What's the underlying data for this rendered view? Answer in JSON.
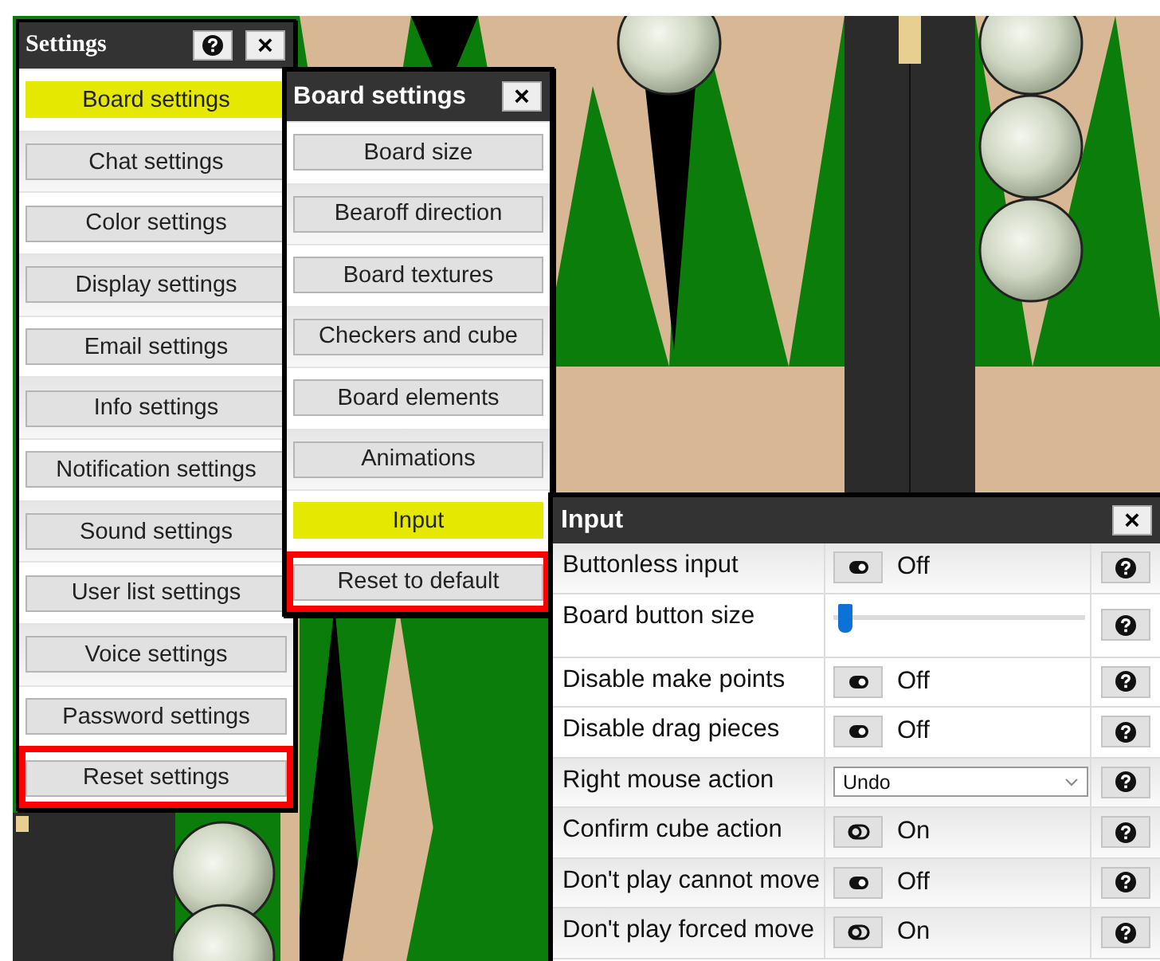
{
  "settings_window": {
    "title": "Settings",
    "close": "×",
    "items": [
      {
        "label": "Board settings",
        "selected": true,
        "kind": "setting"
      },
      {
        "label": "Chat settings",
        "selected": false,
        "kind": "setting"
      },
      {
        "label": "Color settings",
        "selected": false,
        "kind": "setting"
      },
      {
        "label": "Display settings",
        "selected": false,
        "kind": "setting"
      },
      {
        "label": "Email settings",
        "selected": false,
        "kind": "setting"
      },
      {
        "label": "Info settings",
        "selected": false,
        "kind": "setting"
      },
      {
        "label": "Notification settings",
        "selected": false,
        "kind": "setting"
      },
      {
        "label": "Sound settings",
        "selected": false,
        "kind": "setting"
      },
      {
        "label": "User list settings",
        "selected": false,
        "kind": "setting"
      },
      {
        "label": "Voice settings",
        "selected": false,
        "kind": "setting"
      },
      {
        "label": "Password settings",
        "selected": false,
        "kind": "setting"
      },
      {
        "label": "Reset settings",
        "selected": false,
        "kind": "reset"
      }
    ]
  },
  "board_settings_window": {
    "title": "Board settings",
    "close": "×",
    "items": [
      {
        "label": "Board size",
        "selected": false,
        "kind": "setting"
      },
      {
        "label": "Bearoff direction",
        "selected": false,
        "kind": "setting"
      },
      {
        "label": "Board textures",
        "selected": false,
        "kind": "setting"
      },
      {
        "label": "Checkers and cube",
        "selected": false,
        "kind": "setting"
      },
      {
        "label": "Board elements",
        "selected": false,
        "kind": "setting"
      },
      {
        "label": "Animations",
        "selected": false,
        "kind": "setting"
      },
      {
        "label": "Input",
        "selected": true,
        "kind": "setting"
      },
      {
        "label": "Reset to default",
        "selected": false,
        "kind": "reset"
      }
    ]
  },
  "input_window": {
    "title": "Input",
    "close": "×",
    "rows": [
      {
        "label": "Buttonless input",
        "kind": "toggle",
        "on": false,
        "value": "Off"
      },
      {
        "label": "Board button size",
        "kind": "slider",
        "level": 0.02
      },
      {
        "label": "Disable make points",
        "kind": "toggle",
        "on": false,
        "value": "Off"
      },
      {
        "label": "Disable drag pieces",
        "kind": "toggle",
        "on": false,
        "value": "Off"
      },
      {
        "label": "Right mouse action",
        "kind": "select",
        "value": "Undo"
      },
      {
        "label": "Confirm cube action",
        "kind": "toggle",
        "on": true,
        "value": "On"
      },
      {
        "label": "Don't play cannot move",
        "kind": "toggle",
        "on": false,
        "value": "Off"
      },
      {
        "label": "Don't play forced move",
        "kind": "toggle",
        "on": true,
        "value": "On"
      }
    ]
  }
}
